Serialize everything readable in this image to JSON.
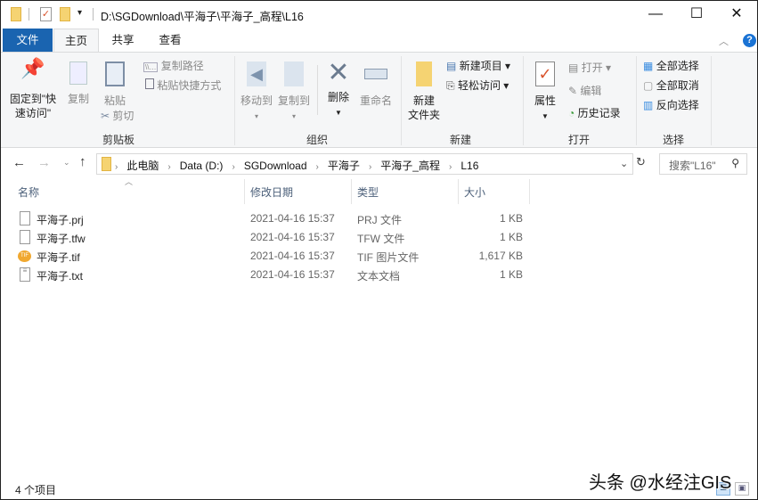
{
  "title": "D:\\SGDownload\\平海子\\平海子_高程\\L16",
  "window_controls": {
    "minimize": "—",
    "maximize": "☐",
    "close": "✕"
  },
  "tabs": [
    "文件",
    "主页",
    "共享",
    "查看"
  ],
  "ribbon": {
    "clipboard": {
      "pin": "固定到\"快",
      "pin2": "速访问\"",
      "copy": "复制",
      "paste": "粘贴",
      "copy_path": "复制路径",
      "paste_shortcut": "粘贴快捷方式",
      "cut": "剪切",
      "label": "剪贴板"
    },
    "organize": {
      "move_to": "移动到",
      "copy_to": "复制到",
      "delete": "删除",
      "rename": "重命名",
      "label": "组织"
    },
    "new": {
      "new_folder": "新建",
      "new_folder2": "文件夹",
      "new_item": "新建项目 ▾",
      "easy_access": "轻松访问 ▾",
      "label": "新建"
    },
    "open": {
      "properties": "属性",
      "open": "打开 ▾",
      "edit": "编辑",
      "history": "历史记录",
      "label": "打开"
    },
    "select": {
      "select_all": "全部选择",
      "select_none": "全部取消",
      "invert": "反向选择",
      "label": "选择"
    }
  },
  "breadcrumb": [
    "此电脑",
    "Data (D:)",
    "SGDownload",
    "平海子",
    "平海子_高程",
    "L16"
  ],
  "search_placeholder": "搜索\"L16\"",
  "columns": [
    "名称",
    "修改日期",
    "类型",
    "大小"
  ],
  "files": [
    {
      "name": "平海子.prj",
      "date": "2021-04-16 15:37",
      "type": "PRJ 文件",
      "size": "1 KB",
      "icon": "file-icon"
    },
    {
      "name": "平海子.tfw",
      "date": "2021-04-16 15:37",
      "type": "TFW 文件",
      "size": "1 KB",
      "icon": "file-icon"
    },
    {
      "name": "平海子.tif",
      "date": "2021-04-16 15:37",
      "type": "TIF 图片文件",
      "size": "1,617 KB",
      "icon": "tiff-icon"
    },
    {
      "name": "平海子.txt",
      "date": "2021-04-16 15:37",
      "type": "文本文档",
      "size": "1 KB",
      "icon": "text-file-icon"
    }
  ],
  "status": "4 个项目",
  "watermark": "头条 @水经注GIS",
  "colors": {
    "file_tab": "#1a64b0",
    "ribbon_bg": "#f5f6f7",
    "header_text": "#4c607a"
  }
}
